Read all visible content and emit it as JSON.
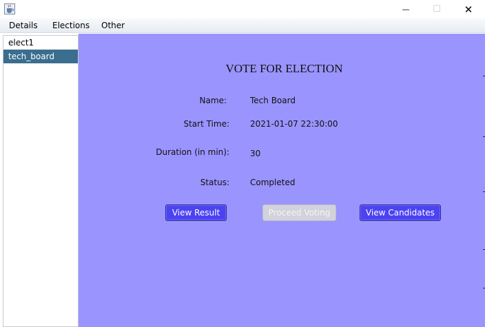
{
  "window": {
    "app_icon": "java-cup-icon",
    "minimize_glyph": "—",
    "maximize_glyph": "☐",
    "close_glyph": "✕"
  },
  "menu": {
    "items": [
      {
        "label": "Details"
      },
      {
        "label": "Elections"
      },
      {
        "label": "Other"
      }
    ]
  },
  "sidebar": {
    "items": [
      {
        "label": "elect1",
        "selected": false
      },
      {
        "label": "tech_board",
        "selected": true
      }
    ]
  },
  "panel": {
    "title": "VOTE FOR ELECTION",
    "fields": {
      "name": {
        "label": "Name:",
        "value": "Tech Board"
      },
      "start_time": {
        "label": "Start Time:",
        "value": "2021-01-07 22:30:00"
      },
      "duration": {
        "label": "Duration (in min):",
        "value": "30"
      },
      "status": {
        "label": "Status:",
        "value": "Completed"
      }
    },
    "buttons": {
      "view_result": "View Result",
      "proceed_voting": "Proceed Voting",
      "view_candidates": "View Candidates"
    }
  },
  "colors": {
    "panel_bg": "#9a94fe",
    "button_primary": "#4b43f2",
    "button_disabled": "#d2d2dc",
    "selection": "#3b6e8e"
  }
}
